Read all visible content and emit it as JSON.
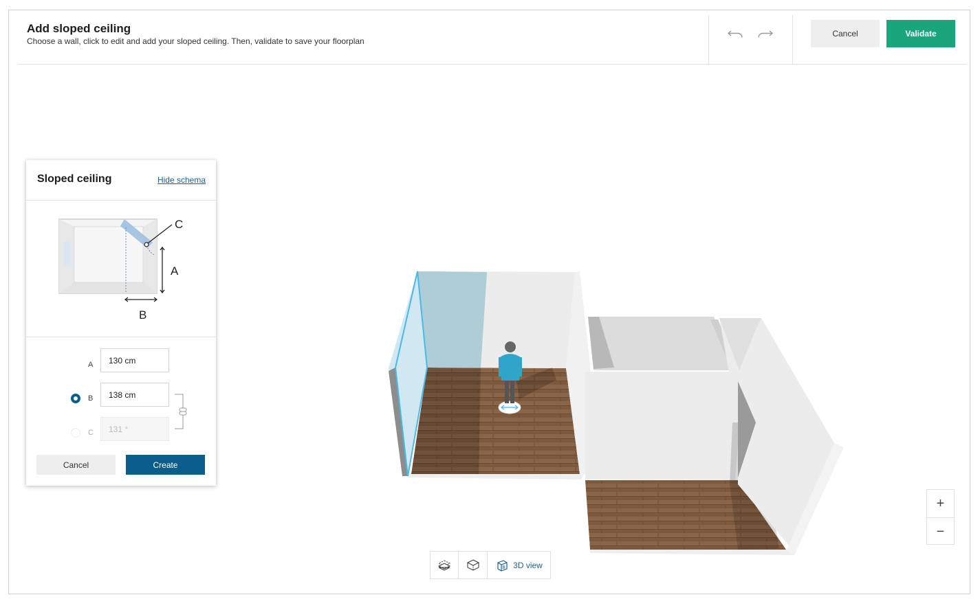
{
  "header": {
    "title": "Add sloped ceiling",
    "subtitle": "Choose a wall, click to edit and add your sloped ceiling. Then, validate to save your floorplan",
    "cancel_label": "Cancel",
    "validate_label": "Validate"
  },
  "panel": {
    "title": "Sloped ceiling",
    "hide_schema_label": "Hide schema",
    "schema_labels": {
      "a": "A",
      "b": "B",
      "c": "C"
    },
    "fields": {
      "a": {
        "label": "A",
        "value": "130 cm"
      },
      "b": {
        "label": "B",
        "value": "138 cm",
        "selected": true
      },
      "c": {
        "label": "C",
        "value": "131 °",
        "disabled": true
      }
    },
    "cancel_label": "Cancel",
    "create_label": "Create"
  },
  "zoom": {
    "in_label": "+",
    "out_label": "−"
  },
  "viewbar": {
    "view3d_label": "3D view"
  },
  "colors": {
    "validate_green": "#1aa57c",
    "primary_blue": "#0b5e8c",
    "link_blue": "#1f5f93",
    "selected_wall": "#4bb8e6"
  }
}
